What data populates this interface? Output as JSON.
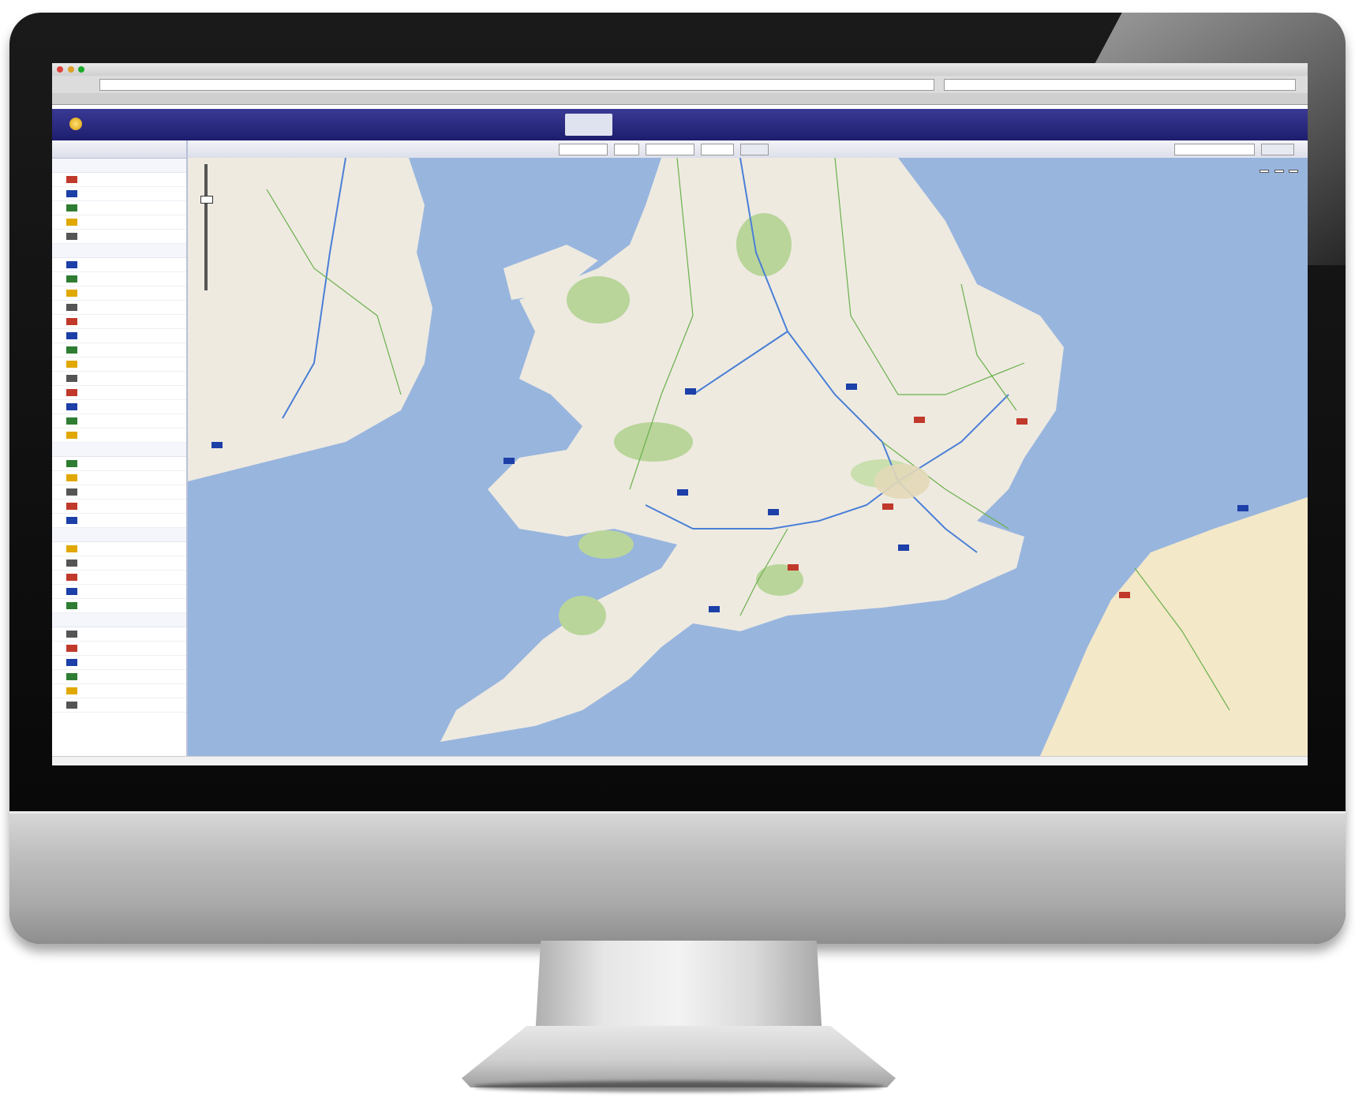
{
  "browser": {
    "window_title": "",
    "url": "",
    "search": "",
    "bookmarks": ""
  },
  "app": {
    "logo_text": "",
    "nav": [
      "",
      "",
      "",
      "",
      "",
      "",
      "",
      ""
    ],
    "user_link": ""
  },
  "sidebar": {
    "toolbar_text": "",
    "groups": [
      {
        "label": "",
        "items": [
          "",
          "",
          "",
          "",
          ""
        ]
      },
      {
        "label": "",
        "items": [
          "",
          "",
          "",
          "",
          "",
          "",
          "",
          "",
          "",
          "",
          "",
          "",
          ""
        ]
      },
      {
        "label": "",
        "items": [
          "",
          "",
          "",
          "",
          ""
        ]
      },
      {
        "label": "",
        "items": [
          "",
          "",
          "",
          "",
          ""
        ]
      },
      {
        "label": "",
        "items": [
          "",
          "",
          "",
          "",
          "",
          ""
        ]
      }
    ]
  },
  "map": {
    "toolbar_label": "",
    "map_types": [
      "",
      "",
      ""
    ]
  },
  "colors": {
    "app_bar": "#2a2a84",
    "sea": "#98b5de",
    "land": "#eeeae0",
    "park": "#b9d59a"
  }
}
